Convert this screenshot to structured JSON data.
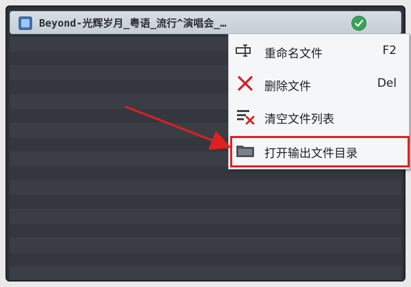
{
  "window": {
    "title": "Beyond-光辉岁月_粤语_流行^演唱会_…",
    "status_icon": "check-circle-icon",
    "file_icon": "video-file-icon"
  },
  "context_menu": {
    "items": [
      {
        "label": "重命名文件",
        "shortcut": "F2",
        "icon": "rename-icon"
      },
      {
        "label": "删除文件",
        "shortcut": "Del",
        "icon": "delete-x-icon"
      },
      {
        "label": "清空文件列表",
        "shortcut": "",
        "icon": "clear-list-icon"
      },
      {
        "label": "打开输出文件目录",
        "shortcut": "",
        "icon": "folder-icon"
      }
    ],
    "highlighted_item_index": 3
  },
  "colors": {
    "panel_bg": "#2f3338",
    "titlebar_bg": "#c6ced6",
    "menu_bg": "#f5f6f7",
    "highlight_red": "#e02020",
    "check_green": "#38a25a"
  }
}
